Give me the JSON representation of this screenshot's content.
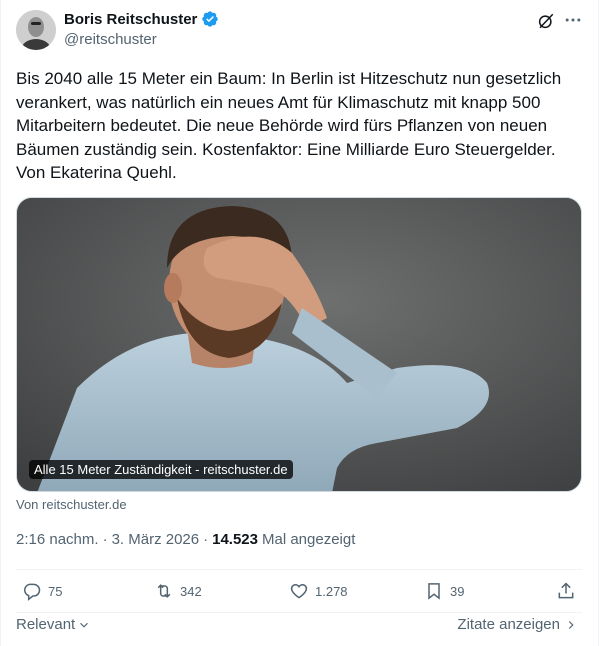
{
  "author": {
    "display_name": "Boris Reitschuster",
    "handle": "@reitschuster",
    "verified": true
  },
  "tweet": {
    "text": "Bis 2040 alle 15 Meter ein Baum: In Berlin ist Hitzeschutz nun gesetzlich verankert, was natürlich ein neues Amt für Klimaschutz mit knapp 500 Mitarbeitern bedeutet. Die neue Behörde wird fürs Pflanzen von neuen Bäumen zuständig sein. Kostenfaktor: Eine Milliarde Euro Steuergelder. Von Ekaterina Quehl."
  },
  "media": {
    "caption": "Alle 15 Meter Zuständigkeit - reitschuster.de",
    "source_label": "Von reitschuster.de"
  },
  "meta": {
    "time": "2:16 nachm.",
    "separator": "·",
    "date": "3. März 2026",
    "views": "14.523",
    "views_label": "Mal angezeigt"
  },
  "actions": {
    "replies": "75",
    "reposts": "342",
    "likes": "1.278",
    "bookmarks": "39"
  },
  "footer": {
    "sort_label": "Relevant",
    "quotes_label": "Zitate anzeigen"
  },
  "colors": {
    "text": "#0f1419",
    "secondary": "#536471",
    "verified": "#1d9bf0",
    "border": "#eff3f4"
  },
  "icons": [
    "verified-badge-icon",
    "grok-icon",
    "more-icon",
    "reply-icon",
    "repost-icon",
    "like-icon",
    "bookmark-icon",
    "share-icon",
    "chevron-down-icon",
    "chevron-right-icon"
  ]
}
